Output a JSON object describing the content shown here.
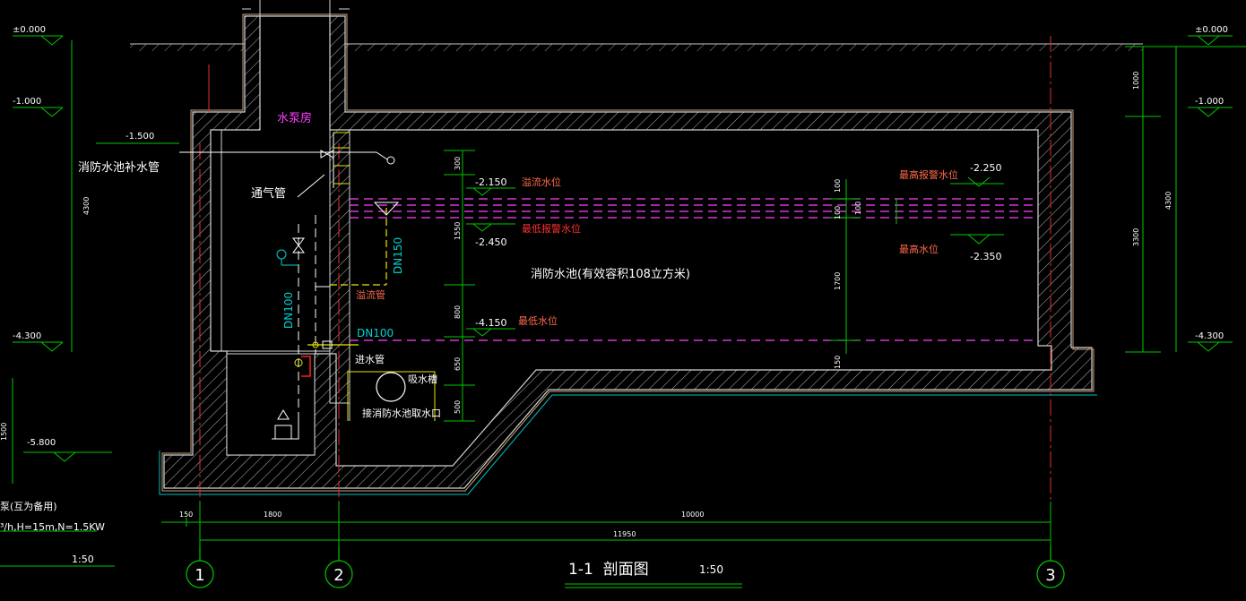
{
  "elevations": {
    "left_top": "±0.000",
    "left_m1000": "-1.000",
    "left_m1500": "-1.500",
    "left_m4300": "-4.300",
    "left_m5800": "-5.800",
    "right_top": "±0.000",
    "right_m1000": "-1.000",
    "right_m4300": "-4.300",
    "overflow_level": "-2.150",
    "low_alarm_level": "-2.450",
    "min_level": "-4.150",
    "high_alarm_level": "-2.250",
    "max_level": "-2.350"
  },
  "labels": {
    "pump_room": "水泵房",
    "fill_pipe": "消防水池补水管",
    "vent_pipe": "通气管",
    "overflow_pipe": "溢流管",
    "inlet_pipe": "进水管",
    "suction_pit": "吸水槽",
    "intake": "接消防水池取水口",
    "pool": "消防水池(有效容积108立方米)",
    "overflow_level": "溢流水位",
    "low_alarm_level": "最低报警水位",
    "min_level": "最低水位",
    "high_alarm_level": "最高报警水位",
    "max_level": "最高水位",
    "dn150": "DN150",
    "dn100_vertical": "DN100",
    "dn100_horizontal": "DN100",
    "pump_note_1": "泵(互为备用)",
    "pump_note_2": "³/h,H=15m,N=1.5KW",
    "left_scale": "1:50"
  },
  "dimensions": {
    "left_4300": "4300",
    "left_1500": "1500",
    "d300": "300",
    "d1550": "1550",
    "d800": "800",
    "d650": "650",
    "d500": "500",
    "d100a": "100",
    "d100b": "100",
    "d100c": "100",
    "d1700": "1700",
    "d150v": "150",
    "right_1000": "1000",
    "right_3300": "3300",
    "right_4300": "4300",
    "bottom_150": "150",
    "bottom_1800": "1800",
    "bottom_10000": "10000",
    "bottom_11950": "11950"
  },
  "axes": [
    "1",
    "2",
    "3"
  ],
  "title": {
    "name": "1-1  剖面图",
    "scale": "1:50"
  },
  "colors": {
    "background": "#000000",
    "wall": "#d4d4d4",
    "dimension": "#00c800",
    "label_red": "#ff6a4a",
    "label_magenta": "#ff40ff",
    "label_cyan": "#00d2d2",
    "label_white": "#ffffff",
    "axis_line": "#e03030",
    "pipe_yellow": "#e8e800"
  }
}
